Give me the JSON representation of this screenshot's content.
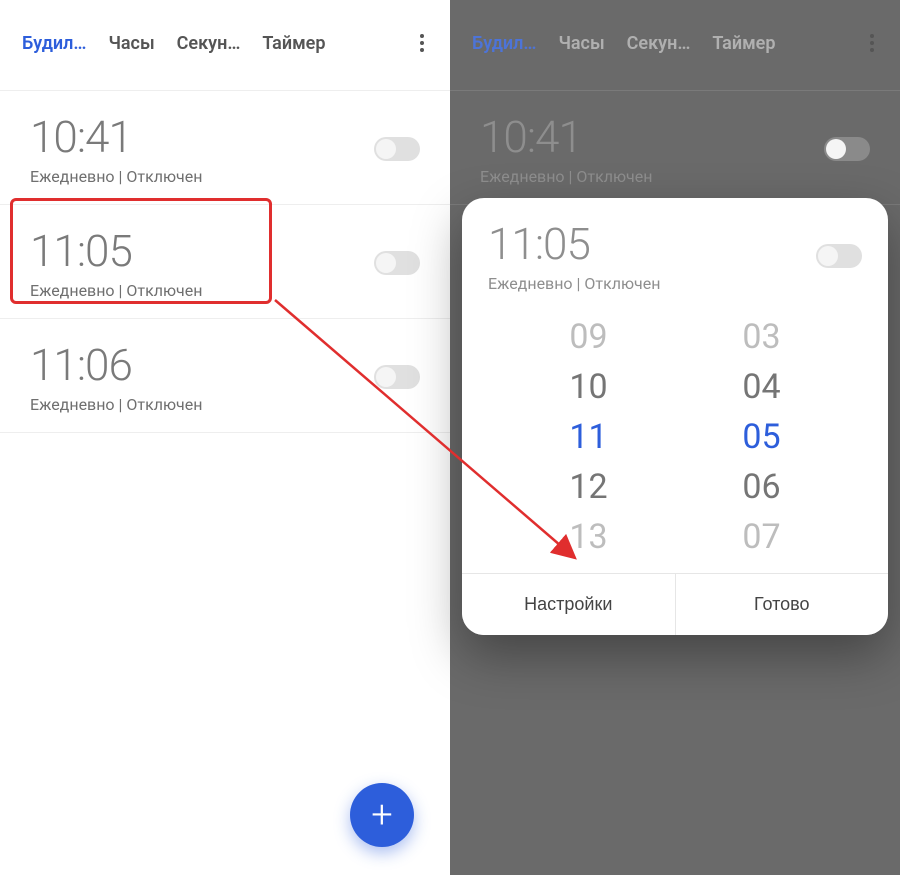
{
  "tabs": {
    "alarm": "Будил…",
    "clock": "Часы",
    "stopwatch": "Секун…",
    "timer": "Таймер"
  },
  "alarms": [
    {
      "time": "10:41",
      "sub": "Ежедневно  |  Отключен"
    },
    {
      "time": "11:05",
      "sub": "Ежедневно  |  Отключен"
    },
    {
      "time": "11:06",
      "sub": "Ежедневно  |  Отключен"
    }
  ],
  "fab": {
    "plus": "+"
  },
  "sheet": {
    "time": "11:05",
    "sub": "Ежедневно  |  Отключен",
    "hours": [
      "09",
      "10",
      "11",
      "12",
      "13"
    ],
    "minutes": [
      "03",
      "04",
      "05",
      "06",
      "07"
    ],
    "selected_hour_index": 2,
    "selected_minute_index": 2,
    "settings": "Настройки",
    "done": "Готово"
  },
  "colors": {
    "accent": "#2d5edb",
    "highlight": "#e02e2e"
  }
}
